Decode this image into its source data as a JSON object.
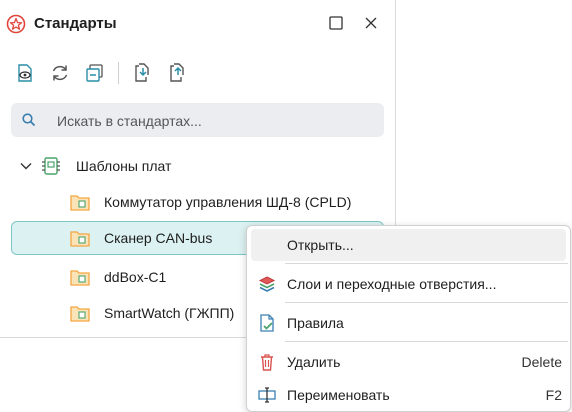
{
  "panel": {
    "title": "Стандарты",
    "app_icon": "star-icon",
    "window_buttons": [
      {
        "name": "maximize-button",
        "icon": "square-icon"
      },
      {
        "name": "close-button",
        "icon": "close-icon"
      }
    ]
  },
  "toolbar": {
    "buttons": [
      {
        "name": "view-standard-button",
        "icon": "document-eye-icon"
      },
      {
        "name": "refresh-button",
        "icon": "refresh-icon"
      },
      {
        "name": "collapse-all-button",
        "icon": "collapse-icon"
      },
      {
        "name": "import-button",
        "icon": "import-icon"
      },
      {
        "name": "export-button",
        "icon": "export-icon"
      }
    ]
  },
  "search": {
    "placeholder": "Искать в стандартах...",
    "value": ""
  },
  "tree": {
    "group": {
      "label": "Шаблоны плат",
      "expanded": true,
      "icon": "board-templates-icon"
    },
    "items": [
      {
        "label": "Коммутатор управления ШД-8 (CPLD)",
        "selected": false
      },
      {
        "label": "Сканер CAN-bus",
        "selected": true
      },
      {
        "label": "ddBox-C1",
        "selected": false
      },
      {
        "label": "SmartWatch (ГЖПП)",
        "selected": false
      }
    ]
  },
  "context_menu": {
    "items": [
      {
        "label": "Открыть...",
        "shortcut": "",
        "icon": "",
        "hover": true
      },
      {
        "label": "Слои и переходные отверстия...",
        "shortcut": "",
        "icon": "layers-icon",
        "hover": false
      },
      {
        "label": "Правила",
        "shortcut": "",
        "icon": "rules-icon",
        "hover": false
      },
      {
        "label": "Удалить",
        "shortcut": "Delete",
        "icon": "trash-icon",
        "hover": false
      },
      {
        "label": "Переименовать",
        "shortcut": "F2",
        "icon": "rename-icon",
        "hover": false
      }
    ]
  },
  "colors": {
    "accent": "#2a9d9d",
    "selected_bg": "#dcf1f1",
    "selected_border": "#7cc6c6",
    "folder": "#f4a742",
    "danger": "#d9534f"
  }
}
